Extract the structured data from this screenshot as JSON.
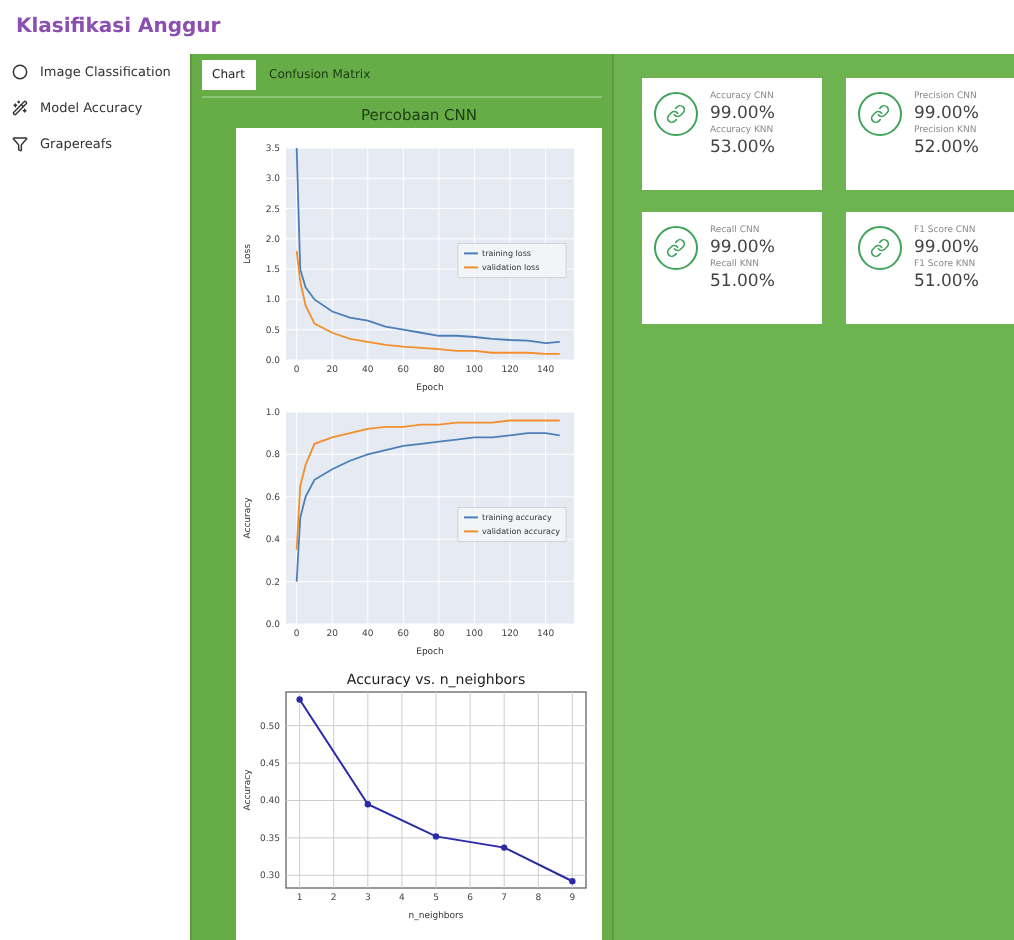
{
  "app_title": "Klasifikasi Anggur",
  "sidebar": {
    "items": [
      {
        "label": "Image Classification",
        "selected": false
      },
      {
        "label": "Model Accuracy",
        "selected": false
      },
      {
        "label": "Grapereafs",
        "selected": false
      }
    ]
  },
  "tabs": [
    {
      "label": "Chart",
      "selected": true
    },
    {
      "label": "Confusion Matrix",
      "selected": false
    }
  ],
  "section_title": "Percobaan CNN",
  "charts": [
    {
      "chart_data": {
        "type": "line",
        "xlabel": "Epoch",
        "ylabel": "Loss",
        "x": [
          0,
          2,
          5,
          10,
          20,
          30,
          40,
          50,
          60,
          70,
          80,
          90,
          100,
          110,
          120,
          130,
          140,
          148
        ],
        "xlim": [
          -6,
          156
        ],
        "ylim": [
          0,
          3.5
        ],
        "xticks": [
          0,
          20,
          40,
          60,
          80,
          100,
          120,
          140
        ],
        "yticks": [
          {
            "value": 0,
            "label": "0.0"
          },
          {
            "value": 0.5,
            "label": "0.5"
          },
          {
            "value": 1,
            "label": "1.0"
          },
          {
            "value": 1.5,
            "label": "1.5"
          },
          {
            "value": 2,
            "label": "2.0"
          },
          {
            "value": 2.5,
            "label": "2.5"
          },
          {
            "value": 3,
            "label": "3.0"
          },
          {
            "value": 3.5,
            "label": "3.5"
          }
        ],
        "grid": true,
        "legend": true,
        "series": [
          {
            "name": "training loss",
            "color": "#4c7fb5",
            "values": [
              3.5,
              1.5,
              1.2,
              1.0,
              0.8,
              0.7,
              0.65,
              0.55,
              0.5,
              0.45,
              0.4,
              0.4,
              0.38,
              0.35,
              0.33,
              0.32,
              0.28,
              0.3
            ]
          },
          {
            "name": "validation loss",
            "color": "#f28e2b",
            "values": [
              1.8,
              1.3,
              0.9,
              0.6,
              0.45,
              0.35,
              0.3,
              0.25,
              0.22,
              0.2,
              0.18,
              0.15,
              0.15,
              0.12,
              0.12,
              0.12,
              0.1,
              0.1
            ]
          }
        ]
      }
    },
    {
      "chart_data": {
        "type": "line",
        "xlabel": "Epoch",
        "ylabel": "Accuracy",
        "x": [
          0,
          2,
          5,
          10,
          20,
          30,
          40,
          50,
          60,
          70,
          80,
          90,
          100,
          110,
          120,
          130,
          140,
          148
        ],
        "xlim": [
          -6,
          156
        ],
        "ylim": [
          0,
          1
        ],
        "xticks": [
          0,
          20,
          40,
          60,
          80,
          100,
          120,
          140
        ],
        "yticks": [
          {
            "value": 0,
            "label": "0.0"
          },
          {
            "value": 0.2,
            "label": "0.2"
          },
          {
            "value": 0.4,
            "label": "0.4"
          },
          {
            "value": 0.6,
            "label": "0.6"
          },
          {
            "value": 0.8,
            "label": "0.8"
          },
          {
            "value": 1,
            "label": "1.0"
          }
        ],
        "grid": true,
        "legend": true,
        "series": [
          {
            "name": "training accuracy",
            "color": "#4c7fb5",
            "values": [
              0.2,
              0.5,
              0.6,
              0.68,
              0.73,
              0.77,
              0.8,
              0.82,
              0.84,
              0.85,
              0.86,
              0.87,
              0.88,
              0.88,
              0.89,
              0.9,
              0.9,
              0.89
            ]
          },
          {
            "name": "validation accuracy",
            "color": "#f28e2b",
            "values": [
              0.35,
              0.65,
              0.75,
              0.85,
              0.88,
              0.9,
              0.92,
              0.93,
              0.93,
              0.94,
              0.94,
              0.95,
              0.95,
              0.95,
              0.96,
              0.96,
              0.96,
              0.96
            ]
          }
        ]
      }
    },
    {
      "chart_data": {
        "type": "line",
        "title": "Accuracy vs. n_neighbors",
        "xlabel": "n_neighbors",
        "ylabel": "Accuracy",
        "x": [
          1,
          3,
          5,
          7,
          9
        ],
        "xlim": [
          0.6,
          9.4
        ],
        "ylim": [
          0.283,
          0.545
        ],
        "xticks": [
          1,
          2,
          3,
          4,
          5,
          6,
          7,
          8,
          9
        ],
        "yticks": [
          {
            "value": 0.3,
            "label": "0.30"
          },
          {
            "value": 0.35,
            "label": "0.35"
          },
          {
            "value": 0.4,
            "label": "0.40"
          },
          {
            "value": 0.45,
            "label": "0.45"
          },
          {
            "value": 0.5,
            "label": "0.50"
          }
        ],
        "grid": true,
        "series": [
          {
            "color": "#2b2ba8",
            "marker": "o",
            "values": [
              0.535,
              0.395,
              0.352,
              0.337,
              0.292
            ]
          }
        ]
      }
    }
  ],
  "metric_cards": [
    {
      "label_cnn": "Accuracy CNN",
      "value_cnn": "99.00%",
      "label_knn": "Accuracy KNN",
      "value_knn": "53.00%"
    },
    {
      "label_cnn": "Precision CNN",
      "value_cnn": "99.00%",
      "label_knn": "Precision KNN",
      "value_knn": "52.00%"
    },
    {
      "label_cnn": "Recall CNN",
      "value_cnn": "99.00%",
      "label_knn": "Recall KNN",
      "value_knn": "51.00%"
    },
    {
      "label_cnn": "F1 Score CNN",
      "value_cnn": "99.00%",
      "label_knn": "F1 Score KNN",
      "value_knn": "51.00%"
    }
  ]
}
